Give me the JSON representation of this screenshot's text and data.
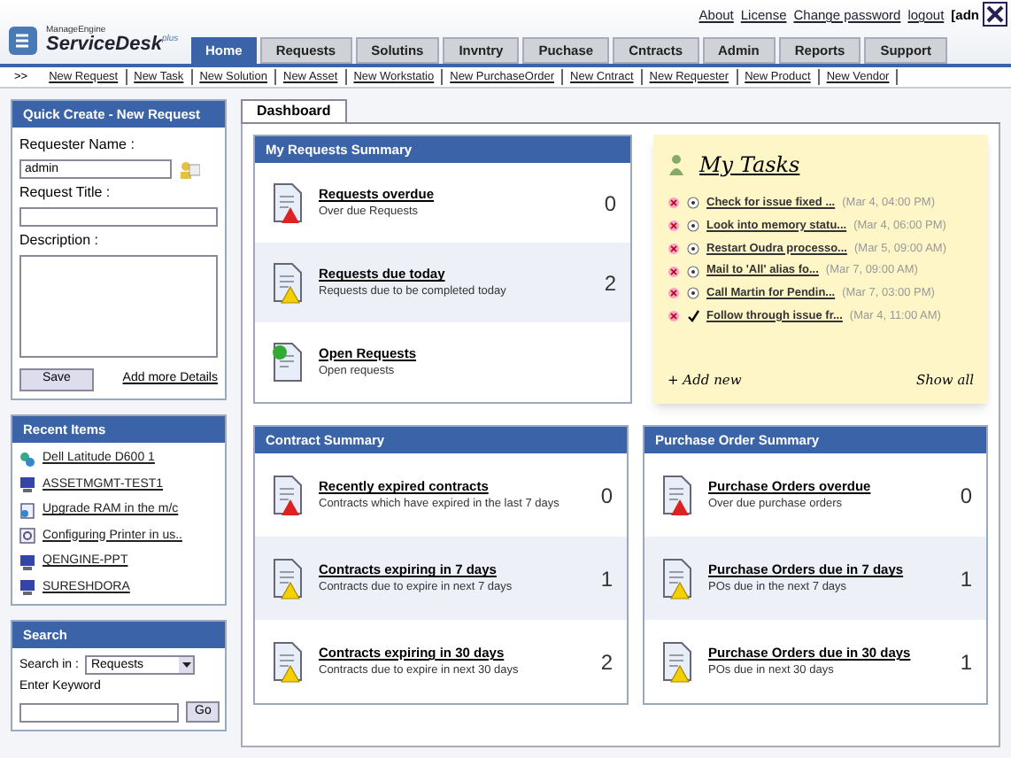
{
  "header": {
    "brand_top": "ManageEngine",
    "brand": "ServiceDesk",
    "brand_sup": "plus",
    "links": [
      "About",
      "License",
      "Change password",
      "logout",
      "[adn"
    ]
  },
  "tabs": [
    {
      "label": "Home",
      "selected": true
    },
    {
      "label": "Requests",
      "selected": false
    },
    {
      "label": "Solutins",
      "selected": false
    },
    {
      "label": "Invntry",
      "selected": false
    },
    {
      "label": "Puchase",
      "selected": false
    },
    {
      "label": "Cntracts",
      "selected": false
    },
    {
      "label": "Admin",
      "selected": false
    },
    {
      "label": "Reports",
      "selected": false
    },
    {
      "label": "Support",
      "selected": false
    }
  ],
  "quick_links": {
    "marker": ">>",
    "items": [
      "New Request",
      "New Task",
      "New Solution",
      "New Asset",
      "New Workstatio",
      "New PurchaseOrder",
      "New Cntract",
      "New Requester",
      "New Product",
      "New Vendor"
    ]
  },
  "quick_create": {
    "title": "Quick Create - New Request",
    "name_label": "Requester Name :",
    "name_value": "admin",
    "title_label": "Request Title :",
    "description_label": "Description :",
    "save": "Save",
    "more": "Add more Details"
  },
  "recent_items": {
    "title": "Recent Items",
    "items": [
      {
        "label": "Dell Latitude D600 1",
        "kind": "asset"
      },
      {
        "label": "ASSETMGMT-TEST1",
        "kind": "computer"
      },
      {
        "label": "Upgrade RAM in the m/c",
        "kind": "request"
      },
      {
        "label": "Configuring Printer in us..",
        "kind": "solution"
      },
      {
        "label": "QENGINE-PPT",
        "kind": "computer"
      },
      {
        "label": "SURESHDORA",
        "kind": "computer"
      }
    ]
  },
  "search": {
    "title": "Search",
    "in_label": "Search in :",
    "in_value": "Requests",
    "keyword_label": "Enter Keyword",
    "go": "Go"
  },
  "dashboard_tab": "Dashboard",
  "panels": [
    {
      "title": "My Requests Summary",
      "rows": [
        {
          "title": "Requests overdue",
          "sub": "Over due Requests",
          "count": "0",
          "kind": "overdue"
        },
        {
          "title": "Requests due today",
          "sub": "Requests due to be completed today",
          "count": "2",
          "kind": "warning"
        },
        {
          "title": "Open Requests",
          "sub": "Open requests",
          "count": "",
          "kind": "open"
        }
      ]
    },
    {
      "title": "Contract Summary",
      "rows": [
        {
          "title": "Recently expired contracts",
          "sub": "Contracts which have expired in the last 7 days",
          "count": "0",
          "kind": "overdue"
        },
        {
          "title": "Contracts expiring in 7 days",
          "sub": "Contracts due to expire in next 7 days",
          "count": "1",
          "kind": "warning"
        },
        {
          "title": "Contracts expiring in 30 days",
          "sub": "Contracts due to expire in next 30 days",
          "count": "2",
          "kind": "warning"
        }
      ]
    },
    {
      "title": "Purchase Order Summary",
      "rows": [
        {
          "title": "Purchase Orders overdue",
          "sub": "Over due purchase orders",
          "count": "0",
          "kind": "overdue"
        },
        {
          "title": "Purchase Orders due in 7 days",
          "sub": "POs due in the next 7 days",
          "count": "1",
          "kind": "warning"
        },
        {
          "title": "Purchase Orders due in 30 days",
          "sub": "POs due in next 30 days",
          "count": "1",
          "kind": "warning"
        }
      ]
    }
  ],
  "tasks": {
    "title": "My Tasks",
    "items": [
      {
        "label": "Check for issue fixed ...",
        "time": "(Mar 4, 04:00 PM)",
        "done": false
      },
      {
        "label": "Look into memory statu...",
        "time": "(Mar 4, 06:00 PM)",
        "done": false
      },
      {
        "label": "Restart Oudra processo...",
        "time": "(Mar 5, 09:00 AM)",
        "done": false
      },
      {
        "label": "Mail to 'All' alias fo...",
        "time": "(Mar 7, 09:00 AM)",
        "done": false
      },
      {
        "label": "Call Martin for Pendin...",
        "time": "(Mar 7, 03:00 PM)",
        "done": false
      },
      {
        "label": "Follow through issue fr...",
        "time": "(Mar 4, 11:00 AM)",
        "done": true
      }
    ],
    "add": "+ Add new",
    "show_all": "Show all"
  }
}
